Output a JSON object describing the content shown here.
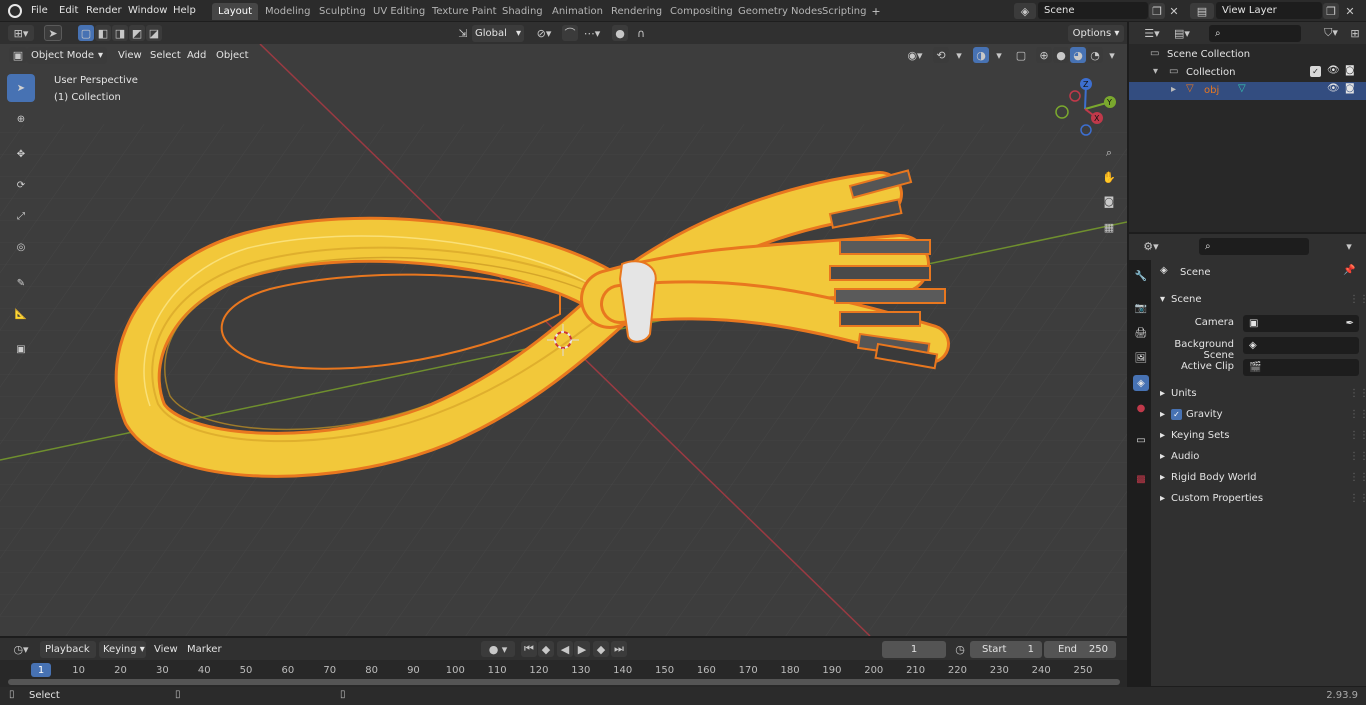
{
  "menu": {
    "file": "File",
    "edit": "Edit",
    "render": "Render",
    "window": "Window",
    "help": "Help"
  },
  "workspaces": [
    "Layout",
    "Modeling",
    "Sculpting",
    "UV Editing",
    "Texture Paint",
    "Shading",
    "Animation",
    "Rendering",
    "Compositing",
    "Geometry Nodes",
    "Scripting"
  ],
  "scene_field": "Scene",
  "view_layer_field": "View Layer",
  "transform": {
    "orientation": "Global",
    "options": "Options"
  },
  "viewport": {
    "mode": "Object Mode",
    "menus": {
      "view": "View",
      "select": "Select",
      "add": "Add",
      "object": "Object"
    },
    "overlay_line1": "User Perspective",
    "overlay_line2": "(1) Collection",
    "gizmo": {
      "z": "Z",
      "y": "Y",
      "x": "X"
    }
  },
  "outliner": {
    "scene_collection": "Scene Collection",
    "collection": "Collection",
    "object": "obj"
  },
  "properties": {
    "header": "Scene",
    "panel": "Scene",
    "camera_label": "Camera",
    "background_label": "Background Scene",
    "clip_label": "Active Clip",
    "sections": [
      "Units",
      "Gravity",
      "Keying Sets",
      "Audio",
      "Rigid Body World",
      "Custom Properties"
    ],
    "gravity_enabled": true
  },
  "timeline": {
    "menus": {
      "playback": "Playback",
      "keying": "Keying",
      "view": "View",
      "marker": "Marker"
    },
    "current_frame": "1",
    "start_label": "Start",
    "start": "1",
    "end_label": "End",
    "end": "250",
    "ticks": [
      "1",
      "10",
      "20",
      "30",
      "40",
      "50",
      "60",
      "70",
      "80",
      "90",
      "100",
      "110",
      "120",
      "130",
      "140",
      "150",
      "160",
      "170",
      "180",
      "190",
      "200",
      "210",
      "220",
      "230",
      "240",
      "250"
    ]
  },
  "status": {
    "left": "Select",
    "version": "2.93.9"
  },
  "colors": {
    "accent": "#4772b3",
    "object_outline": "#e8771f",
    "cable": "#f2c83a",
    "x_axis": "#c0394a",
    "y_axis": "#7aa82e"
  }
}
